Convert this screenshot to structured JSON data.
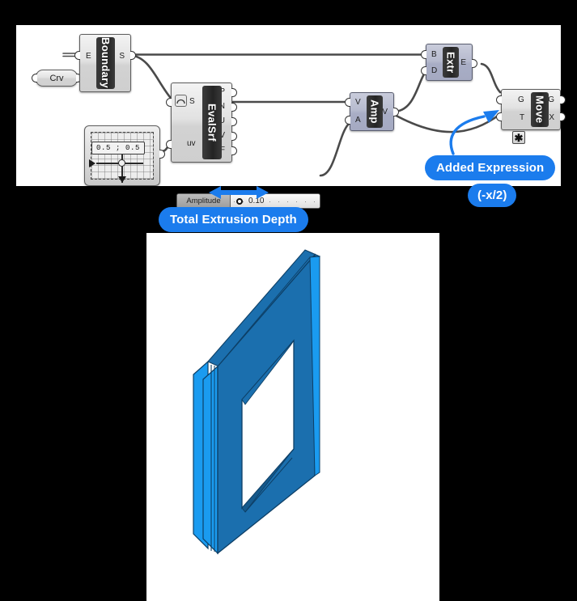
{
  "app": {
    "type": "grasshopper-definition-screenshot",
    "accent_color": "#1b7ced",
    "canvas_bg": "#ffffff",
    "page_bg": "#000000"
  },
  "canvas": {
    "params": [
      {
        "id": "crv",
        "label": "Crv",
        "kind": "curve-parameter"
      }
    ],
    "components": [
      {
        "id": "boundary",
        "name": "Boundary",
        "inputs": [
          "E"
        ],
        "outputs": [
          "S"
        ],
        "selected": false
      },
      {
        "id": "evalsrf",
        "name": "EvalSrf",
        "inputs": [
          "S",
          "uv"
        ],
        "outputs": [
          "P",
          "N",
          "U",
          "V",
          "F"
        ],
        "selected": false
      },
      {
        "id": "amp",
        "name": "Amp",
        "inputs": [
          "V",
          "A"
        ],
        "outputs": [
          "V"
        ],
        "selected": true
      },
      {
        "id": "extr",
        "name": "Extr",
        "inputs": [
          "B",
          "D"
        ],
        "outputs": [
          "E"
        ],
        "selected": true
      },
      {
        "id": "move",
        "name": "Move",
        "inputs": [
          "G",
          "T"
        ],
        "outputs": [
          "G",
          "X"
        ],
        "selected": false,
        "input_expression_on": "T",
        "expression_icon": "asterisk-icon"
      }
    ],
    "md_slider": {
      "id": "md-slider",
      "kind": "md-slider",
      "value": "0.5 ; 0.5"
    },
    "number_slider": {
      "id": "amplitude-slider",
      "label": "Amplitude",
      "value": "0.10"
    }
  },
  "annotations": {
    "added_expression": "Added Expression",
    "expression_value": "(-x/2)",
    "total_extrusion_depth": "Total Extrusion Depth",
    "arrow_icons": {
      "depth_arrow": "double-headed-arrow-icon",
      "callout_arrow": "curved-arrow-icon"
    }
  },
  "viewport": {
    "title": "",
    "geometry": "extruded-rectangular-frame",
    "colors": {
      "front_face": "#1a9bf0",
      "top_face": "#1b6fae",
      "inner_face": "#1b6fae",
      "edge": "#0d3f66",
      "background": "#ffffff"
    }
  }
}
